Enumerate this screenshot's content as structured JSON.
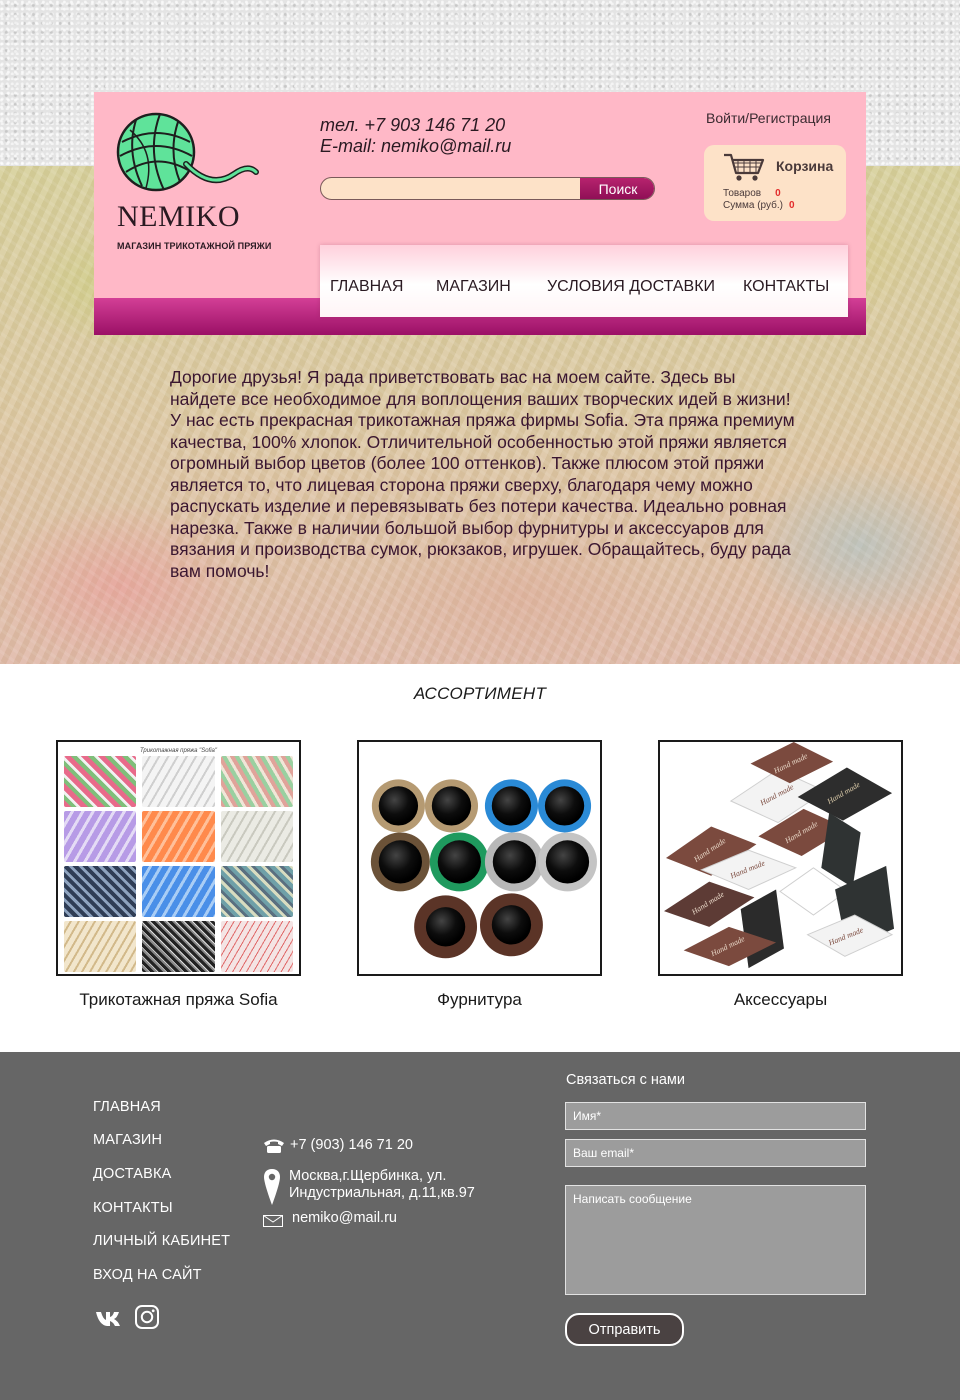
{
  "header": {
    "logo_name": "NEMIKO",
    "logo_tagline": "МАГАЗИН ТРИКОТАЖНОЙ ПРЯЖИ",
    "phone": "тел. +7 903 146 71 20",
    "email": "E-mail: nemiko@mail.ru",
    "search": {
      "placeholder": "",
      "value": "",
      "button_label": "Поиск"
    },
    "login_label": "Войти/Регистрация",
    "cart": {
      "title": "Корзина",
      "items_label": "Товаров",
      "items_count": "0",
      "sum_label": "Сумма (руб.)",
      "sum_value": "0"
    },
    "nav": [
      {
        "label": "ГЛАВНАЯ"
      },
      {
        "label": "МАГАЗИН"
      },
      {
        "label": "УСЛОВИЯ ДОСТАВКИ"
      },
      {
        "label": "КОНТАКТЫ"
      }
    ]
  },
  "intro": {
    "text": "Дорогие друзья! Я рада приветствовать вас на моем сайте. Здесь вы найдете все необходимое для воплощения ваших творческих идей в жизни! У нас есть прекрасная трикотажная пряжа фирмы Sofia. Эта пряжа премиум качества, 100% хлопок. Отличительной особенностью этой пряжи является огромный выбор цветов (более 100 оттенков). Также плюсом этой пряжи является то, что лицевая сторона пряжи сверху, благодаря чему можно распускать изделие и перевязывать без потери качества. Идеально ровная нарезка. Также в наличии большой выбор фурнитуры и аксессуаров для вязания и производства сумок, рюкзаков, игрушек. Обращайтесь, буду рада вам помочь!"
  },
  "assortment": {
    "title": "АССОРТИМЕНТ",
    "yarn_header": "Трикотажная пряжа \"Sofia\"",
    "products": [
      {
        "label": "Трикотажная пряжа Sofia"
      },
      {
        "label": "Фурнитура"
      },
      {
        "label": "Аксессуары"
      }
    ],
    "tag_text": "Hand made"
  },
  "footer": {
    "links": [
      {
        "label": "ГЛАВНАЯ"
      },
      {
        "label": "МАГАЗИН"
      },
      {
        "label": "ДОСТАВКА"
      },
      {
        "label": "КОНТАКТЫ"
      },
      {
        "label": "ЛИЧНЫЙ КАБИНЕТ"
      },
      {
        "label": "ВХОД НА САЙТ"
      }
    ],
    "phone": "+7 (903) 146 71 20",
    "address_line1": "Москва,г.Щербинка, ул.",
    "address_line2": "Индустриальная, д.11,кв.97",
    "email": "nemiko@mail.ru",
    "form": {
      "title": "Связаться с нами",
      "name_placeholder": "Имя*",
      "email_placeholder": "Ваш email*",
      "message_placeholder": "Написать сообщение",
      "submit_label": "Отправить"
    }
  },
  "colors": {
    "header_pink": "#ffb8c7",
    "accent_magenta": "#b8246f",
    "cart_bg": "#fde2c8",
    "logo_green": "#5fe39a",
    "footer_gray": "#666666",
    "count_red": "#e22c2c"
  }
}
